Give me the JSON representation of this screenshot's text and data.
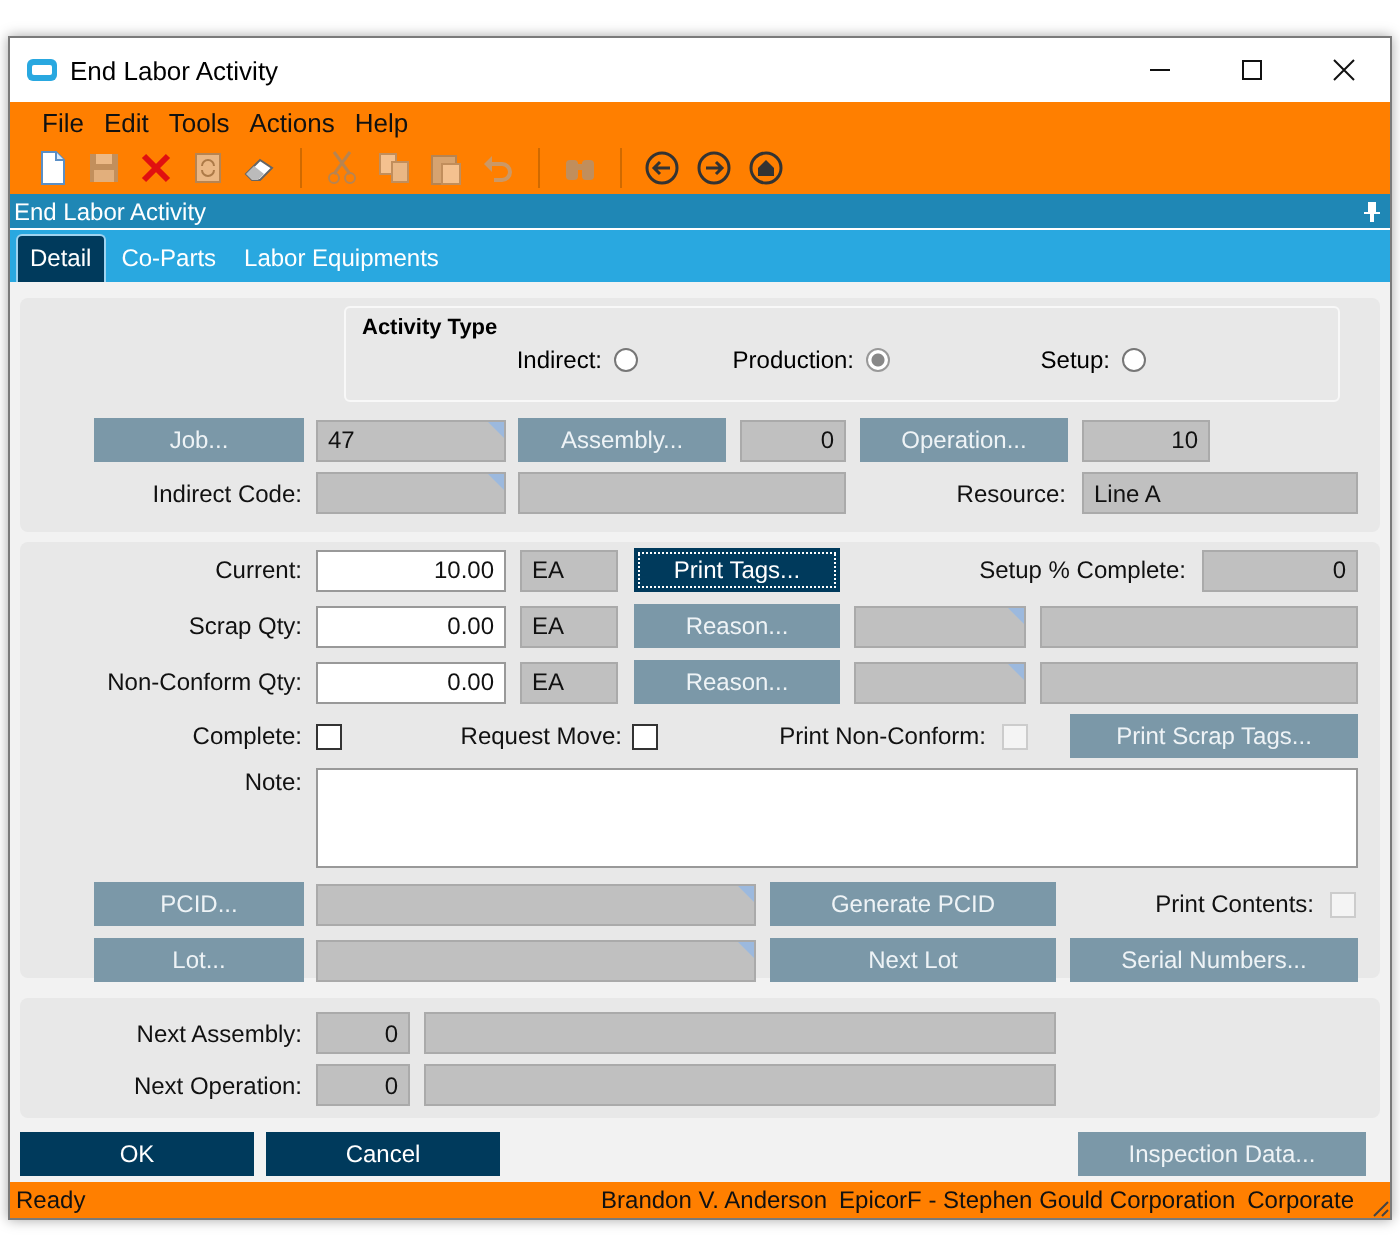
{
  "window": {
    "title": "End Labor Activity"
  },
  "menu": [
    "File",
    "Edit",
    "Tools",
    "Actions",
    "Help"
  ],
  "toolbar": [
    {
      "kind": "new",
      "disabled": false
    },
    {
      "kind": "save",
      "disabled": true
    },
    {
      "kind": "delete",
      "disabled": false
    },
    {
      "kind": "refresh",
      "disabled": true
    },
    {
      "kind": "clear",
      "disabled": false
    },
    {
      "kind": "sep"
    },
    {
      "kind": "cut",
      "disabled": true
    },
    {
      "kind": "copy",
      "disabled": true
    },
    {
      "kind": "paste",
      "disabled": true
    },
    {
      "kind": "undo",
      "disabled": true
    },
    {
      "kind": "sep"
    },
    {
      "kind": "search",
      "disabled": true
    },
    {
      "kind": "sep"
    },
    {
      "kind": "back",
      "disabled": false
    },
    {
      "kind": "forward",
      "disabled": false
    },
    {
      "kind": "home",
      "disabled": false
    }
  ],
  "panel_title": "End Labor Activity",
  "tabs": [
    {
      "label": "Detail",
      "selected": true
    },
    {
      "label": "Co-Parts",
      "selected": false
    },
    {
      "label": "Labor Equipments",
      "selected": false
    }
  ],
  "activity_type": {
    "title": "Activity Type",
    "options": [
      {
        "label": "Indirect:",
        "selected": false
      },
      {
        "label": "Production:",
        "selected": true
      },
      {
        "label": "Setup:",
        "selected": false
      }
    ]
  },
  "job": {
    "button": {
      "label": "Job...",
      "disabled": true
    },
    "value": "47"
  },
  "assembly": {
    "button": {
      "label": "Assembly...",
      "disabled": true
    },
    "value": "0"
  },
  "operation": {
    "button": {
      "label": "Operation...",
      "disabled": true
    },
    "value": "10"
  },
  "indirect_code": {
    "label": "Indirect Code:"
  },
  "resource": {
    "label": "Resource:",
    "value": "Line A"
  },
  "current": {
    "label": "Current:",
    "value": "10.00",
    "uom": "EA"
  },
  "print_tags": {
    "label": "Print Tags...",
    "disabled": false
  },
  "setup_complete": {
    "label": "Setup % Complete:",
    "value": "0"
  },
  "scrap_qty": {
    "label": "Scrap Qty:",
    "value": "0.00",
    "uom": "EA",
    "reason": {
      "label": "Reason...",
      "disabled": true
    }
  },
  "nonconform_qty": {
    "label": "Non-Conform Qty:",
    "value": "0.00",
    "uom": "EA",
    "reason": {
      "label": "Reason...",
      "disabled": true
    }
  },
  "complete": {
    "label": "Complete:",
    "checked": false,
    "disabled": false
  },
  "request_move": {
    "label": "Request Move:",
    "checked": false,
    "disabled": false
  },
  "print_nonconform": {
    "label": "Print Non-Conform:",
    "checked": false,
    "disabled": true
  },
  "print_scrap_tags": {
    "label": "Print Scrap Tags...",
    "disabled": true
  },
  "note": {
    "label": "Note:"
  },
  "pcid": {
    "label": "PCID...",
    "disabled": true
  },
  "generate_pcid": {
    "label": "Generate PCID",
    "disabled": true
  },
  "print_contents": {
    "label": "Print Contents:",
    "checked": false,
    "disabled": true
  },
  "lot": {
    "label": "Lot...",
    "disabled": true
  },
  "next_lot": {
    "label": "Next Lot",
    "disabled": true
  },
  "serial_numbers": {
    "label": "Serial Numbers...",
    "disabled": true
  },
  "next_assembly": {
    "label": "Next Assembly:",
    "value": "0"
  },
  "next_operation": {
    "label": "Next Operation:",
    "value": "0"
  },
  "ok": {
    "label": "OK",
    "disabled": false
  },
  "cancel": {
    "label": "Cancel",
    "disabled": false
  },
  "inspection_data": {
    "label": "Inspection Data...",
    "disabled": true
  },
  "status_bar": {
    "status": "Ready",
    "user": "Brandon V. Anderson",
    "company": "EpicorF - Stephen Gould Corporation",
    "site": "Corporate"
  }
}
